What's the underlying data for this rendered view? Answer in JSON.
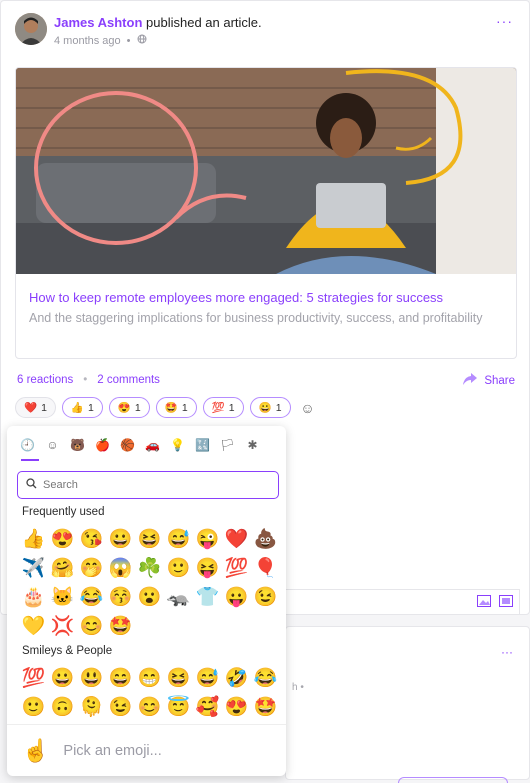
{
  "post": {
    "author": "James Ashton",
    "action": "published an article.",
    "time": "4 months ago",
    "separator": "•"
  },
  "article": {
    "title": "How to keep remote employees more engaged: 5 strategies for success",
    "subtitle": "And the staggering implications for business productivity, success, and profitability"
  },
  "stats": {
    "reactions": "6 reactions",
    "dot": "•",
    "comments": "2 comments",
    "share": "Share"
  },
  "reactions": [
    {
      "emoji": "❤️",
      "count": "1"
    },
    {
      "emoji": "👍",
      "count": "1"
    },
    {
      "emoji": "😍",
      "count": "1"
    },
    {
      "emoji": "🤩",
      "count": "1"
    },
    {
      "emoji": "💯",
      "count": "1"
    },
    {
      "emoji": "😀",
      "count": "1"
    }
  ],
  "picker": {
    "categories": [
      "🕘",
      "☺",
      "🐻",
      "🍎",
      "🏀",
      "🚗",
      "💡",
      "🔣",
      "🏳",
      "✱"
    ],
    "search_placeholder": "Search",
    "frequent_title": "Frequently used",
    "frequent": [
      "👍",
      "😍",
      "😘",
      "😀",
      "😆",
      "😅",
      "😜",
      "❤️",
      "💩",
      "✈️",
      "🤗",
      "🤭",
      "😱",
      "☘️",
      "🙂",
      "😝",
      "💯",
      "🎈",
      "🎂",
      "🐱",
      "😂",
      "😚",
      "😮",
      "🦡",
      "👕",
      "😛",
      "😉",
      "💛",
      "💢",
      "😊",
      "🤩"
    ],
    "smileys_title": "Smileys & People",
    "smileys": [
      "💯",
      "😀",
      "😃",
      "😄",
      "😁",
      "😆",
      "😅",
      "🤣",
      "😂",
      "🙂",
      "🙃",
      "🫠",
      "😉",
      "😊",
      "😇",
      "🥰",
      "😍",
      "🤩"
    ],
    "footer_hand": "☝️",
    "footer_text": "Pick an emoji..."
  },
  "card2": {
    "more": "···",
    "meta": "h •"
  },
  "colors": {
    "accent": "#8a3ffc"
  }
}
